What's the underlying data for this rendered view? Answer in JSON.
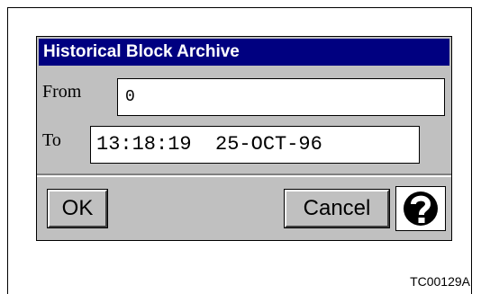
{
  "dialog": {
    "title": "Historical Block Archive",
    "from_label": "From",
    "from_value": "0",
    "to_label": "To",
    "to_value": "13:18:19  25-OCT-96",
    "ok_label": "OK",
    "cancel_label": "Cancel",
    "help_icon": "question-mark-icon"
  },
  "figure_tag": "TC00129A"
}
